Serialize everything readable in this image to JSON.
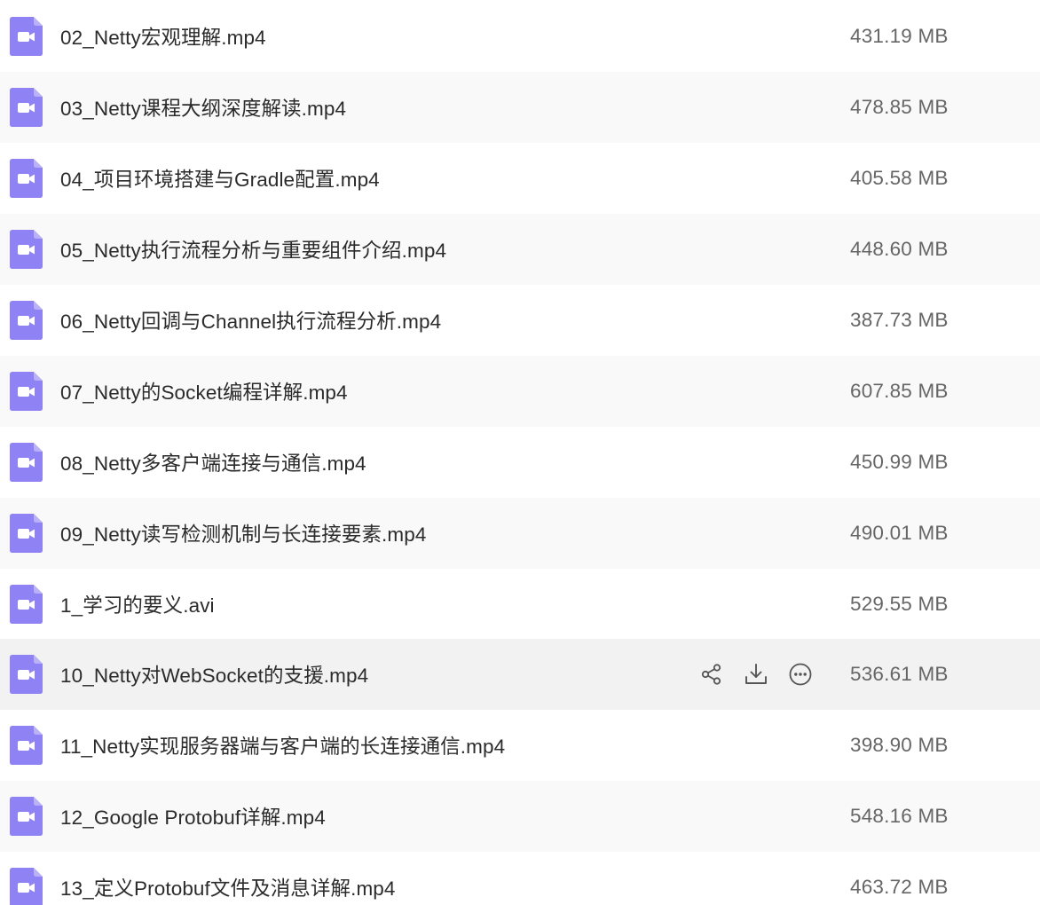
{
  "colors": {
    "icon_fill": "#8e82f4",
    "icon_fold": "#b9b1f9",
    "row_alt": "#f9f9f9",
    "row_hover": "#f2f2f2",
    "text": "#2b2b2b",
    "size_text": "#666666",
    "action_icon": "#555555"
  },
  "file_icon": "video-file-icon",
  "hover_actions": {
    "share_icon": "share-icon",
    "download_icon": "download-icon",
    "more_icon": "more-icon"
  },
  "files": [
    {
      "name": "02_Netty宏观理解.mp4",
      "size": "431.19 MB"
    },
    {
      "name": "03_Netty课程大纲深度解读.mp4",
      "size": "478.85 MB"
    },
    {
      "name": "04_项目环境搭建与Gradle配置.mp4",
      "size": "405.58 MB"
    },
    {
      "name": "05_Netty执行流程分析与重要组件介绍.mp4",
      "size": "448.60 MB"
    },
    {
      "name": "06_Netty回调与Channel执行流程分析.mp4",
      "size": "387.73 MB"
    },
    {
      "name": "07_Netty的Socket编程详解.mp4",
      "size": "607.85 MB"
    },
    {
      "name": "08_Netty多客户端连接与通信.mp4",
      "size": "450.99 MB"
    },
    {
      "name": "09_Netty读写检测机制与长连接要素.mp4",
      "size": "490.01 MB"
    },
    {
      "name": "1_学习的要义.avi",
      "size": "529.55 MB"
    },
    {
      "name": "10_Netty对WebSocket的支援.mp4",
      "size": "536.61 MB"
    },
    {
      "name": "11_Netty实现服务器端与客户端的长连接通信.mp4",
      "size": "398.90 MB"
    },
    {
      "name": "12_Google Protobuf详解.mp4",
      "size": "548.16 MB"
    },
    {
      "name": "13_定义Protobuf文件及消息详解.mp4",
      "size": "463.72 MB"
    }
  ]
}
